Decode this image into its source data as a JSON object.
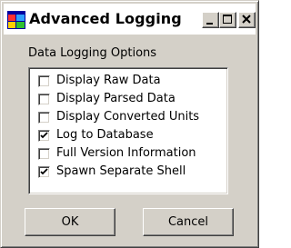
{
  "window": {
    "title": "Advanced Logging",
    "icon": "app-window-icon",
    "controls": {
      "minimize_icon": "minimize-icon",
      "maximize_icon": "maximize-icon",
      "close_icon": "close-icon"
    }
  },
  "group": {
    "label": "Data Logging Options"
  },
  "options": [
    {
      "label": "Display Raw Data",
      "checked": false
    },
    {
      "label": "Display Parsed Data",
      "checked": false
    },
    {
      "label": "Display Converted Units",
      "checked": false
    },
    {
      "label": "Log to Database",
      "checked": true
    },
    {
      "label": "Full Version Information",
      "checked": false
    },
    {
      "label": "Spawn Separate Shell",
      "checked": true
    }
  ],
  "buttons": {
    "ok_label": "OK",
    "cancel_label": "Cancel"
  },
  "colors": {
    "face": "#d4d0c8",
    "titlebar": "#ffffff",
    "list_bg": "#ffffff"
  }
}
